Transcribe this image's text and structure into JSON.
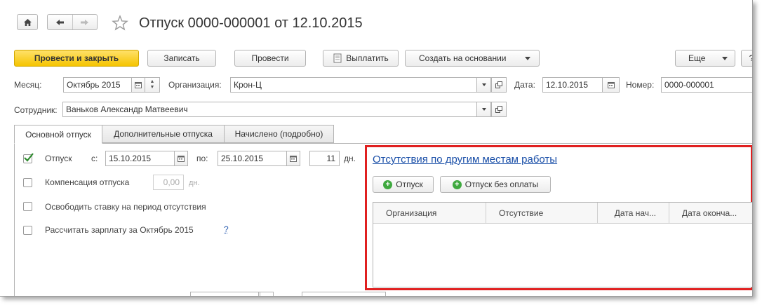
{
  "header": {
    "title": "Отпуск 0000-000001 от 12.10.2015",
    "star_icon": "star-icon",
    "home_icon": "home-icon",
    "back_icon": "arrow-left-icon",
    "forward_icon": "arrow-right-icon"
  },
  "toolbar": {
    "post_close": "Провести и закрыть",
    "save": "Записать",
    "post": "Провести",
    "pay": "Выплатить",
    "create_based": "Создать на основании",
    "more": "Еще",
    "help": "?"
  },
  "fields": {
    "month_label": "Месяц:",
    "month_value": "Октябрь 2015",
    "org_label": "Организация:",
    "org_value": "Крон-Ц",
    "date_label": "Дата:",
    "date_value": "12.10.2015",
    "number_label": "Номер:",
    "number_value": "0000-000001",
    "employee_label": "Сотрудник:",
    "employee_value": "Ваньков Александр Матвеевич"
  },
  "tabs": [
    {
      "label": "Основной отпуск",
      "active": true
    },
    {
      "label": "Дополнительные отпуска",
      "active": false
    },
    {
      "label": "Начислено (подробно)",
      "active": false
    }
  ],
  "main_tab": {
    "vacation_label": "Отпуск",
    "vacation_checked": true,
    "from_label": "с:",
    "from_value": "15.10.2015",
    "to_label": "по:",
    "to_value": "25.10.2015",
    "days_value": "11",
    "days_unit": "дн.",
    "compensation_label": "Компенсация отпуска",
    "compensation_value": "0,00",
    "compensation_unit": "дн.",
    "free_rate_label": "Освободить ставку на период отсутствия",
    "calc_salary_label": "Рассчитать зарплату за Октябрь 2015",
    "calc_salary_help": "?"
  },
  "absences": {
    "title": "Отсутствия по другим местам работы",
    "add_vacation": "Отпуск",
    "add_unpaid": "Отпуск без оплаты",
    "columns": [
      "Организация",
      "Отсутствие",
      "Дата нач...",
      "Дата оконча..."
    ],
    "rows": [],
    "highlight_color": "#e02020"
  }
}
